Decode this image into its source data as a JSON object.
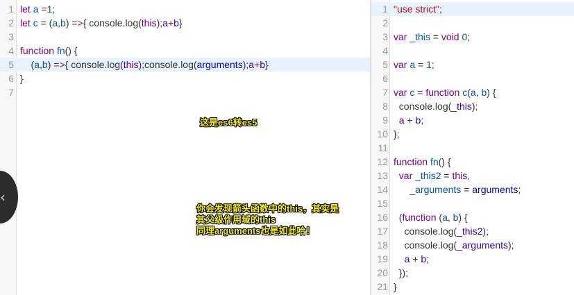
{
  "editor_left": {
    "lines": [
      {
        "n": "1",
        "highlight": false,
        "tokens": [
          {
            "t": "let ",
            "c": "k"
          },
          {
            "t": "a",
            "c": "d"
          },
          {
            "t": " ",
            "c": "p"
          },
          {
            "t": "=",
            "c": "o"
          },
          {
            "t": "1",
            "c": "n"
          },
          {
            "t": ";",
            "c": "p"
          }
        ]
      },
      {
        "n": "2",
        "highlight": false,
        "tokens": [
          {
            "t": "let ",
            "c": "k"
          },
          {
            "t": "c",
            "c": "d"
          },
          {
            "t": " ",
            "c": "p"
          },
          {
            "t": "=",
            "c": "o"
          },
          {
            "t": " (",
            "c": "p"
          },
          {
            "t": "a",
            "c": "d"
          },
          {
            "t": ",",
            "c": "p"
          },
          {
            "t": "b",
            "c": "d"
          },
          {
            "t": ") ",
            "c": "p"
          },
          {
            "t": "=>",
            "c": "o"
          },
          {
            "t": "{ console.log(",
            "c": "p"
          },
          {
            "t": "this",
            "c": "k"
          },
          {
            "t": ");",
            "c": "p"
          },
          {
            "t": "a",
            "c": "vp"
          },
          {
            "t": "+",
            "c": "o"
          },
          {
            "t": "b",
            "c": "vp"
          },
          {
            "t": "}",
            "c": "p"
          }
        ]
      },
      {
        "n": "3",
        "highlight": false,
        "tokens": []
      },
      {
        "n": "4",
        "highlight": false,
        "tokens": [
          {
            "t": "function ",
            "c": "k"
          },
          {
            "t": "fn",
            "c": "d"
          },
          {
            "t": "() {",
            "c": "p"
          }
        ]
      },
      {
        "n": "5",
        "highlight": true,
        "tokens": [
          {
            "t": "    (",
            "c": "p"
          },
          {
            "t": "a",
            "c": "d"
          },
          {
            "t": ",",
            "c": "p"
          },
          {
            "t": "b",
            "c": "d"
          },
          {
            "t": ") ",
            "c": "p"
          },
          {
            "t": "=>",
            "c": "o"
          },
          {
            "t": "{ console.log(",
            "c": "p"
          },
          {
            "t": "this",
            "c": "k"
          },
          {
            "t": ");console.log(",
            "c": "p"
          },
          {
            "t": "arguments",
            "c": "v"
          },
          {
            "t": ");",
            "c": "p"
          },
          {
            "t": "a",
            "c": "vp"
          },
          {
            "t": "+",
            "c": "o"
          },
          {
            "t": "b",
            "c": "vp"
          },
          {
            "t": "}",
            "c": "p"
          }
        ]
      },
      {
        "n": "6",
        "highlight": false,
        "tokens": [
          {
            "t": "}",
            "c": "p"
          }
        ]
      },
      {
        "n": "7",
        "highlight": false,
        "tokens": []
      }
    ]
  },
  "editor_right": {
    "lines": [
      {
        "n": "1",
        "highlight": true,
        "tokens": [
          {
            "t": "\"use strict\"",
            "c": "s"
          },
          {
            "t": ";",
            "c": "p"
          }
        ]
      },
      {
        "n": "2",
        "highlight": false,
        "tokens": []
      },
      {
        "n": "3",
        "highlight": false,
        "tokens": [
          {
            "t": "var ",
            "c": "k"
          },
          {
            "t": "_this",
            "c": "d"
          },
          {
            "t": " = ",
            "c": "p"
          },
          {
            "t": "void ",
            "c": "k"
          },
          {
            "t": "0",
            "c": "n"
          },
          {
            "t": ";",
            "c": "p"
          }
        ]
      },
      {
        "n": "4",
        "highlight": false,
        "tokens": []
      },
      {
        "n": "5",
        "highlight": false,
        "tokens": [
          {
            "t": "var ",
            "c": "k"
          },
          {
            "t": "a",
            "c": "d"
          },
          {
            "t": " = ",
            "c": "p"
          },
          {
            "t": "1",
            "c": "n"
          },
          {
            "t": ";",
            "c": "p"
          }
        ]
      },
      {
        "n": "6",
        "highlight": false,
        "tokens": []
      },
      {
        "n": "7",
        "highlight": false,
        "tokens": [
          {
            "t": "var ",
            "c": "k"
          },
          {
            "t": "c",
            "c": "d"
          },
          {
            "t": " = ",
            "c": "p"
          },
          {
            "t": "function ",
            "c": "k"
          },
          {
            "t": "c",
            "c": "d"
          },
          {
            "t": "(",
            "c": "p"
          },
          {
            "t": "a",
            "c": "d"
          },
          {
            "t": ", ",
            "c": "p"
          },
          {
            "t": "b",
            "c": "d"
          },
          {
            "t": ") {",
            "c": "p"
          }
        ]
      },
      {
        "n": "8",
        "highlight": false,
        "tokens": [
          {
            "t": "  console.log(",
            "c": "p"
          },
          {
            "t": "_this",
            "c": "vp"
          },
          {
            "t": ");",
            "c": "p"
          }
        ]
      },
      {
        "n": "9",
        "highlight": false,
        "tokens": [
          {
            "t": "  ",
            "c": "p"
          },
          {
            "t": "a",
            "c": "vp"
          },
          {
            "t": " + ",
            "c": "p"
          },
          {
            "t": "b",
            "c": "vp"
          },
          {
            "t": ";",
            "c": "p"
          }
        ]
      },
      {
        "n": "10",
        "highlight": false,
        "tokens": [
          {
            "t": "};",
            "c": "p"
          }
        ]
      },
      {
        "n": "11",
        "highlight": false,
        "tokens": []
      },
      {
        "n": "12",
        "highlight": false,
        "tokens": [
          {
            "t": "function ",
            "c": "k"
          },
          {
            "t": "fn",
            "c": "d"
          },
          {
            "t": "() {",
            "c": "p"
          }
        ]
      },
      {
        "n": "13",
        "highlight": false,
        "tokens": [
          {
            "t": "  ",
            "c": "p"
          },
          {
            "t": "var ",
            "c": "k"
          },
          {
            "t": "_this2",
            "c": "d"
          },
          {
            "t": " = ",
            "c": "p"
          },
          {
            "t": "this",
            "c": "k"
          },
          {
            "t": ",",
            "c": "p"
          }
        ]
      },
      {
        "n": "14",
        "highlight": false,
        "tokens": [
          {
            "t": "      ",
            "c": "p"
          },
          {
            "t": "_arguments",
            "c": "d"
          },
          {
            "t": " = ",
            "c": "p"
          },
          {
            "t": "arguments",
            "c": "v"
          },
          {
            "t": ";",
            "c": "p"
          }
        ]
      },
      {
        "n": "15",
        "highlight": false,
        "tokens": []
      },
      {
        "n": "16",
        "highlight": false,
        "tokens": [
          {
            "t": "  (",
            "c": "p"
          },
          {
            "t": "function ",
            "c": "k"
          },
          {
            "t": "(",
            "c": "p"
          },
          {
            "t": "a",
            "c": "d"
          },
          {
            "t": ", ",
            "c": "p"
          },
          {
            "t": "b",
            "c": "d"
          },
          {
            "t": ") {",
            "c": "p"
          }
        ]
      },
      {
        "n": "17",
        "highlight": false,
        "tokens": [
          {
            "t": "    console.log(",
            "c": "p"
          },
          {
            "t": "_this2",
            "c": "vp"
          },
          {
            "t": ");",
            "c": "p"
          }
        ]
      },
      {
        "n": "18",
        "highlight": false,
        "tokens": [
          {
            "t": "    console.log(",
            "c": "p"
          },
          {
            "t": "_arguments",
            "c": "vp"
          },
          {
            "t": ");",
            "c": "p"
          }
        ]
      },
      {
        "n": "19",
        "highlight": false,
        "tokens": [
          {
            "t": "    ",
            "c": "p"
          },
          {
            "t": "a",
            "c": "vp"
          },
          {
            "t": " + ",
            "c": "p"
          },
          {
            "t": "b",
            "c": "vp"
          },
          {
            "t": ";",
            "c": "p"
          }
        ]
      },
      {
        "n": "20",
        "highlight": false,
        "tokens": [
          {
            "t": "  });",
            "c": "p"
          }
        ]
      },
      {
        "n": "21",
        "highlight": false,
        "tokens": [
          {
            "t": "}",
            "c": "p"
          }
        ]
      }
    ]
  },
  "annotations": {
    "note1": "这是es6转es5",
    "note2_lines": [
      "你会发现箭头函数中的this，其实是",
      "其父级作用域的this",
      "同理arguments也是如此哈！"
    ]
  },
  "nav": {
    "prev_icon": "close-icon",
    "prev_glyph": "‹"
  },
  "colors": {
    "keyword": "#770088",
    "variable": "#0000cc",
    "variable_prop": "#3300aa",
    "definition": "#0055aa",
    "number": "#116644",
    "string": "#aa1111",
    "operator": "#981a1a",
    "annotation_text": "#f5ee16",
    "line_highlight": "#e8f2ff"
  }
}
